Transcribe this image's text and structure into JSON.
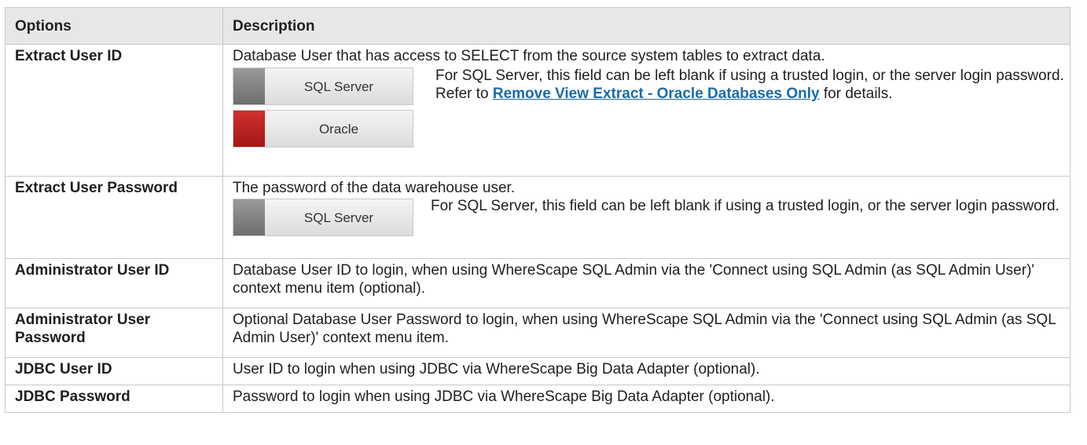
{
  "headers": {
    "options": "Options",
    "description": "Description"
  },
  "rows": {
    "extract_user_id": {
      "option": "Extract User ID",
      "line1": "Database User that has access to SELECT from the source system tables to extract data.",
      "badges": [
        {
          "label": "SQL Server",
          "swatch": "#888888"
        },
        {
          "label": "Oracle",
          "swatch": "#c02020"
        }
      ],
      "sql_note": "For SQL Server, this field can be left blank if using a trusted login, or the server login password.",
      "refer_prefix": "Refer to ",
      "refer_link": "Remove View Extract - Oracle Databases Only",
      "refer_suffix": " for details."
    },
    "extract_user_password": {
      "option": "Extract User Password",
      "line1": "The password of the data warehouse user.",
      "badge": {
        "label": "SQL Server",
        "swatch": "#888888"
      },
      "sql_note": "For SQL Server, this field can be left blank if using a trusted login, or the server login password."
    },
    "administrator_user_id": {
      "option": "Administrator User ID",
      "description": "Database User ID to login, when using WhereScape SQL Admin via the 'Connect using SQL Admin (as SQL Admin User)' context menu item (optional)."
    },
    "administrator_user_password": {
      "option": "Administrator User Password",
      "description": "Optional Database User Password to login, when using WhereScape SQL Admin via the 'Connect using SQL Admin (as SQL Admin User)' context menu item."
    },
    "jdbc_user_id": {
      "option": "JDBC User ID",
      "description": "User ID to login when using JDBC via WhereScape Big Data Adapter (optional)."
    },
    "jdbc_password": {
      "option": "JDBC Password",
      "description": "Password to login when using JDBC via WhereScape Big Data Adapter (optional)."
    }
  }
}
